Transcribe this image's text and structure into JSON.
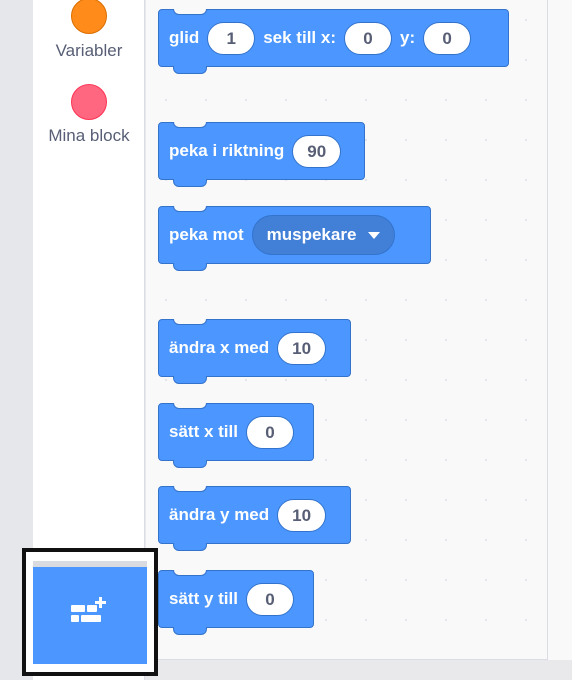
{
  "categories": [
    {
      "label": "Variabler",
      "color": "#ff8c1a"
    },
    {
      "label": "Mina block",
      "color": "#ff6680"
    }
  ],
  "blocks": {
    "glide": {
      "word1": "glid",
      "secs": "1",
      "word2": "sek till x:",
      "x": "0",
      "word3": "y:",
      "y": "0"
    },
    "point_direction": {
      "word": "peka i riktning",
      "value": "90"
    },
    "point_towards": {
      "word": "peka mot",
      "menu": "muspekare"
    },
    "change_x": {
      "word": "ändra x med",
      "value": "10"
    },
    "set_x": {
      "word": "sätt x till",
      "value": "0"
    },
    "change_y": {
      "word": "ändra y med",
      "value": "10"
    },
    "set_y": {
      "word": "sätt y till",
      "value": "0"
    }
  },
  "colors": {
    "motion_block": "#4c97ff",
    "motion_border": "#3373cc",
    "menu_text": "#575e75"
  },
  "extension_button": {
    "icon": "add-extension-icon"
  }
}
